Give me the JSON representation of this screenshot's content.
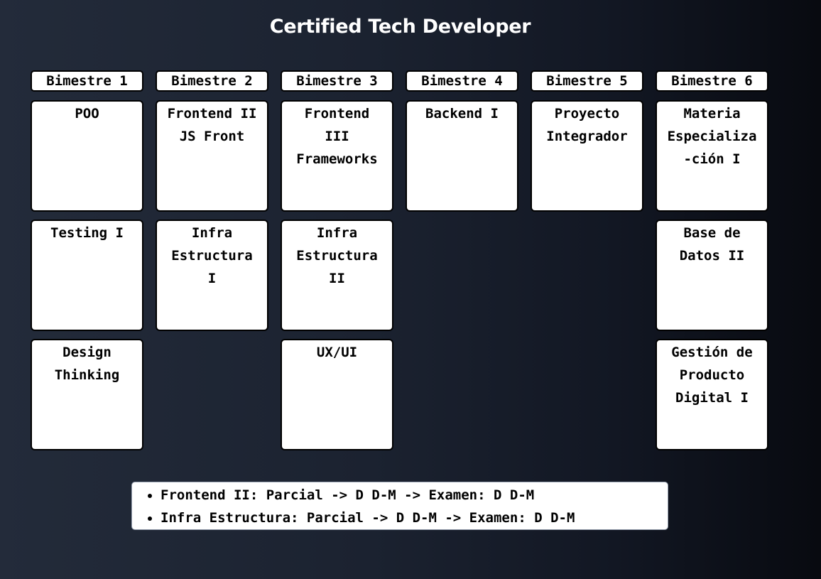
{
  "title": "Certified Tech Developer",
  "columns": [
    {
      "header": "Bimestre 1",
      "subjects": [
        "POO",
        "Testing I",
        "Design\nThinking"
      ]
    },
    {
      "header": "Bimestre 2",
      "subjects": [
        "Frontend II\nJS Front",
        "Infra\nEstructura\nI"
      ]
    },
    {
      "header": "Bimestre 3",
      "subjects": [
        "Frontend\nIII\nFrameworks",
        "Infra\nEstructura\nII",
        "UX/UI"
      ]
    },
    {
      "header": "Bimestre 4",
      "subjects": [
        "Backend I"
      ]
    },
    {
      "header": "Bimestre 5",
      "subjects": [
        "Proyecto\nIntegrador"
      ]
    },
    {
      "header": "Bimestre 6",
      "subjects": [
        "Materia\nEspecializa\n-ción I",
        "Base de\nDatos II",
        "Gestión de\nProducto\nDigital I"
      ]
    }
  ],
  "notes": [
    "Frontend II: Parcial -> D D-M -> Examen: D D-M",
    "Infra Estructura: Parcial -> D D-M -> Examen: D D-M"
  ]
}
